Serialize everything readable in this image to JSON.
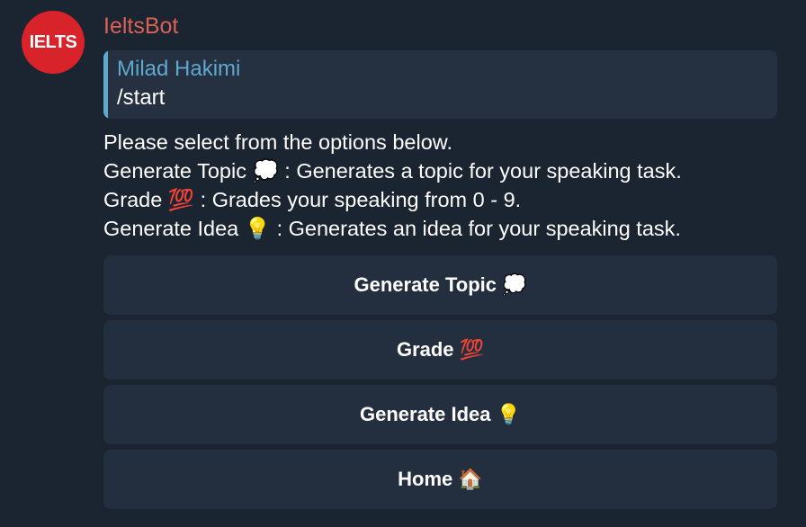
{
  "bot": {
    "name": "IeltsBot",
    "avatar_text": "IELTS"
  },
  "reply": {
    "author": "Milad Hakimi",
    "text": "/start"
  },
  "message": {
    "lines": [
      "Please select from the options below.",
      "Generate Topic 💭 : Generates a topic for your speaking task.",
      "Grade 💯 : Grades your speaking from 0 - 9.",
      "Generate Idea 💡 : Generates an idea for your speaking task."
    ]
  },
  "keyboard": {
    "buttons": [
      "Generate Topic 💭",
      "Grade 💯",
      "Generate Idea 💡",
      "Home 🏠"
    ]
  },
  "colors": {
    "background": "#1b2431",
    "sender": "#d96255",
    "reply_accent": "#5fa8cf",
    "avatar": "#d9232a",
    "button": "#232f3e"
  }
}
